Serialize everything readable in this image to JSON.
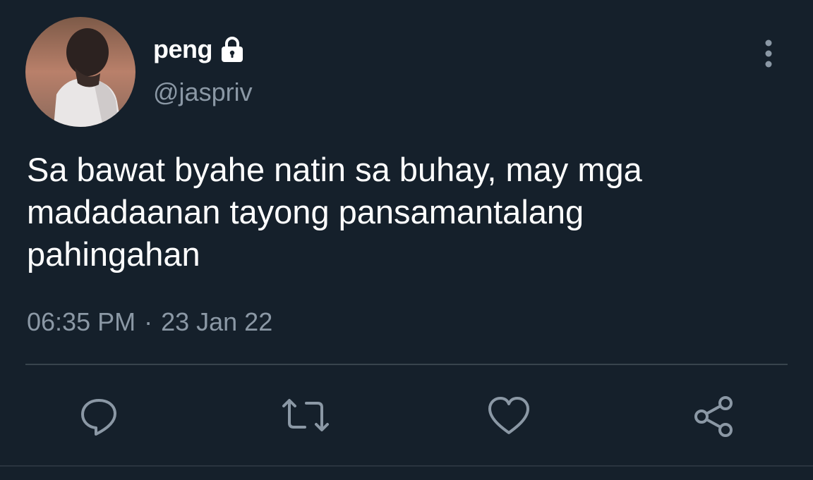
{
  "user": {
    "display_name": "peng",
    "handle": "@jaspriv",
    "protected": true
  },
  "tweet": {
    "lines": [
      "Sa bawat byahe natin sa buhay, may mga",
      "madadaanan tayong pansamantalang",
      "pahingahan"
    ],
    "time": "06:35 PM",
    "separator": "·",
    "date": "23 Jan 22"
  },
  "actions": [
    {
      "icon": "reply-icon"
    },
    {
      "icon": "retweet-icon"
    },
    {
      "icon": "like-icon"
    },
    {
      "icon": "share-icon"
    }
  ],
  "colors": {
    "background": "#15202b",
    "primary_text": "#ffffff",
    "secondary_text": "#8b98a5",
    "divider": "#38444d"
  }
}
